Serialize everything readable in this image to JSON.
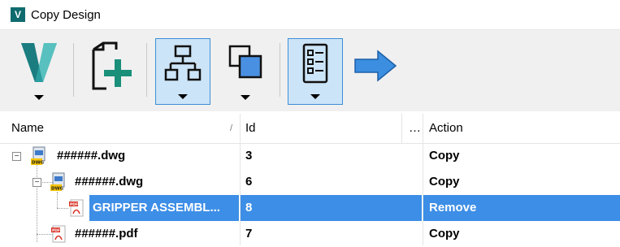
{
  "window": {
    "title": "Copy Design",
    "app_icon_letter": "V"
  },
  "toolbar": {
    "buttons": [
      {
        "name": "vault-logo",
        "icon": "autodesk-vault-v-icon",
        "dropdown": true
      },
      {
        "name": "new-file",
        "icon": "new-file-plus-icon",
        "dropdown": false
      },
      {
        "name": "tree-view",
        "icon": "hierarchy-tree-icon",
        "dropdown": true,
        "selected": true
      },
      {
        "name": "overlap-view",
        "icon": "overlapping-squares-icon",
        "dropdown": true
      },
      {
        "name": "list-view",
        "icon": "list-icon",
        "dropdown": true,
        "selected": true
      },
      {
        "name": "next",
        "icon": "right-arrow-icon",
        "dropdown": false
      }
    ]
  },
  "grid": {
    "columns": {
      "name": "Name",
      "id": "Id",
      "more": "…",
      "action": "Action"
    },
    "rows": [
      {
        "name": "######.dwg",
        "id": "3",
        "action": "Copy",
        "type": "dwg",
        "level": 0,
        "selected": false
      },
      {
        "name": "######.dwg",
        "id": "6",
        "action": "Copy",
        "type": "dwg",
        "level": 1,
        "selected": false
      },
      {
        "name": "GRIPPER ASSEMBL...",
        "id": "8",
        "action": "Remove",
        "type": "pdf",
        "level": 2,
        "selected": true
      },
      {
        "name": "######.pdf",
        "id": "7",
        "action": "Copy",
        "type": "pdf",
        "level": 1,
        "selected": false
      }
    ]
  },
  "colors": {
    "selection": "#3d8ee6",
    "accent": "#1a73e8",
    "arrow": "#3c8fe0",
    "plus": "#1a8f7a"
  }
}
